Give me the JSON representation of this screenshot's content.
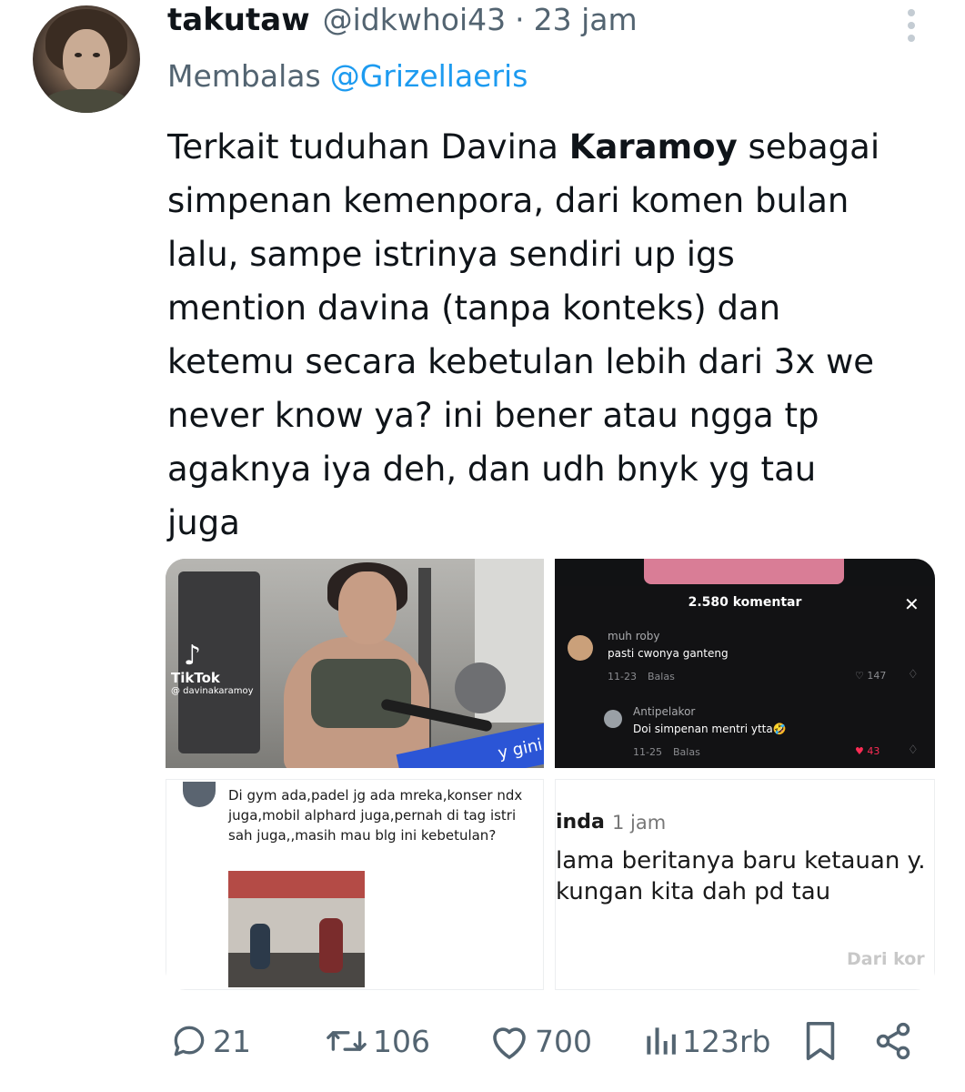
{
  "tweet": {
    "display_name": "takutaw",
    "handle": "@idkwhoi43",
    "separator": "·",
    "time": "23 jam",
    "replying_label": "Membalas",
    "replying_to": "@Grizellaeris",
    "text_lines": [
      {
        "pre": "Terkait tuduhan Davina ",
        "bold": "Karamoy",
        "post": " sebagai"
      },
      {
        "pre": "simpenan kemenpora, dari komen bulan"
      },
      {
        "pre": "lalu, sampe istrinya sendiri up igs"
      },
      {
        "pre": "mention davina (tanpa konteks) dan"
      },
      {
        "pre": "ketemu secara kebetulan lebih dari 3x we"
      },
      {
        "pre": "never know ya? ini bener atau ngga tp"
      },
      {
        "pre": "agaknya iya deh, dan udh bnyk yg tau"
      },
      {
        "pre": "juga"
      }
    ]
  },
  "media": {
    "image1": {
      "watermark_app": "TikTok",
      "watermark_handle": "@ davinakaramoy",
      "banner_text": "y gini 😙🔥"
    },
    "image2": {
      "title": "2.580 komentar",
      "close_icon": "✕",
      "comments": [
        {
          "name": "muh roby",
          "text": "pasti cwonya ganteng",
          "date": "11-23",
          "reply": "Balas",
          "likes": "147"
        },
        {
          "name": "Antipelakor",
          "text": "Doi simpenan mentri ytta🤣",
          "date": "11-25",
          "reply": "Balas",
          "likes": "43"
        }
      ]
    },
    "image3": {
      "text": "Di gym ada,padel jg ada mreka,konser ndx juga,mobil alphard juga,pernah di tag istri sah juga,,masih mau blg ini kebetulan?"
    },
    "image4": {
      "name": "inda",
      "time": "1 jam",
      "line1": "lama beritanya baru ketauan y.",
      "line2": "kungan kita dah pd tau",
      "watermark": "Dari kor"
    }
  },
  "actions": {
    "replies": "21",
    "reposts": "106",
    "likes": "700",
    "views": "123rb"
  },
  "colors": {
    "text": "#0f1419",
    "secondary": "#536471",
    "link": "#1d9bf0"
  }
}
